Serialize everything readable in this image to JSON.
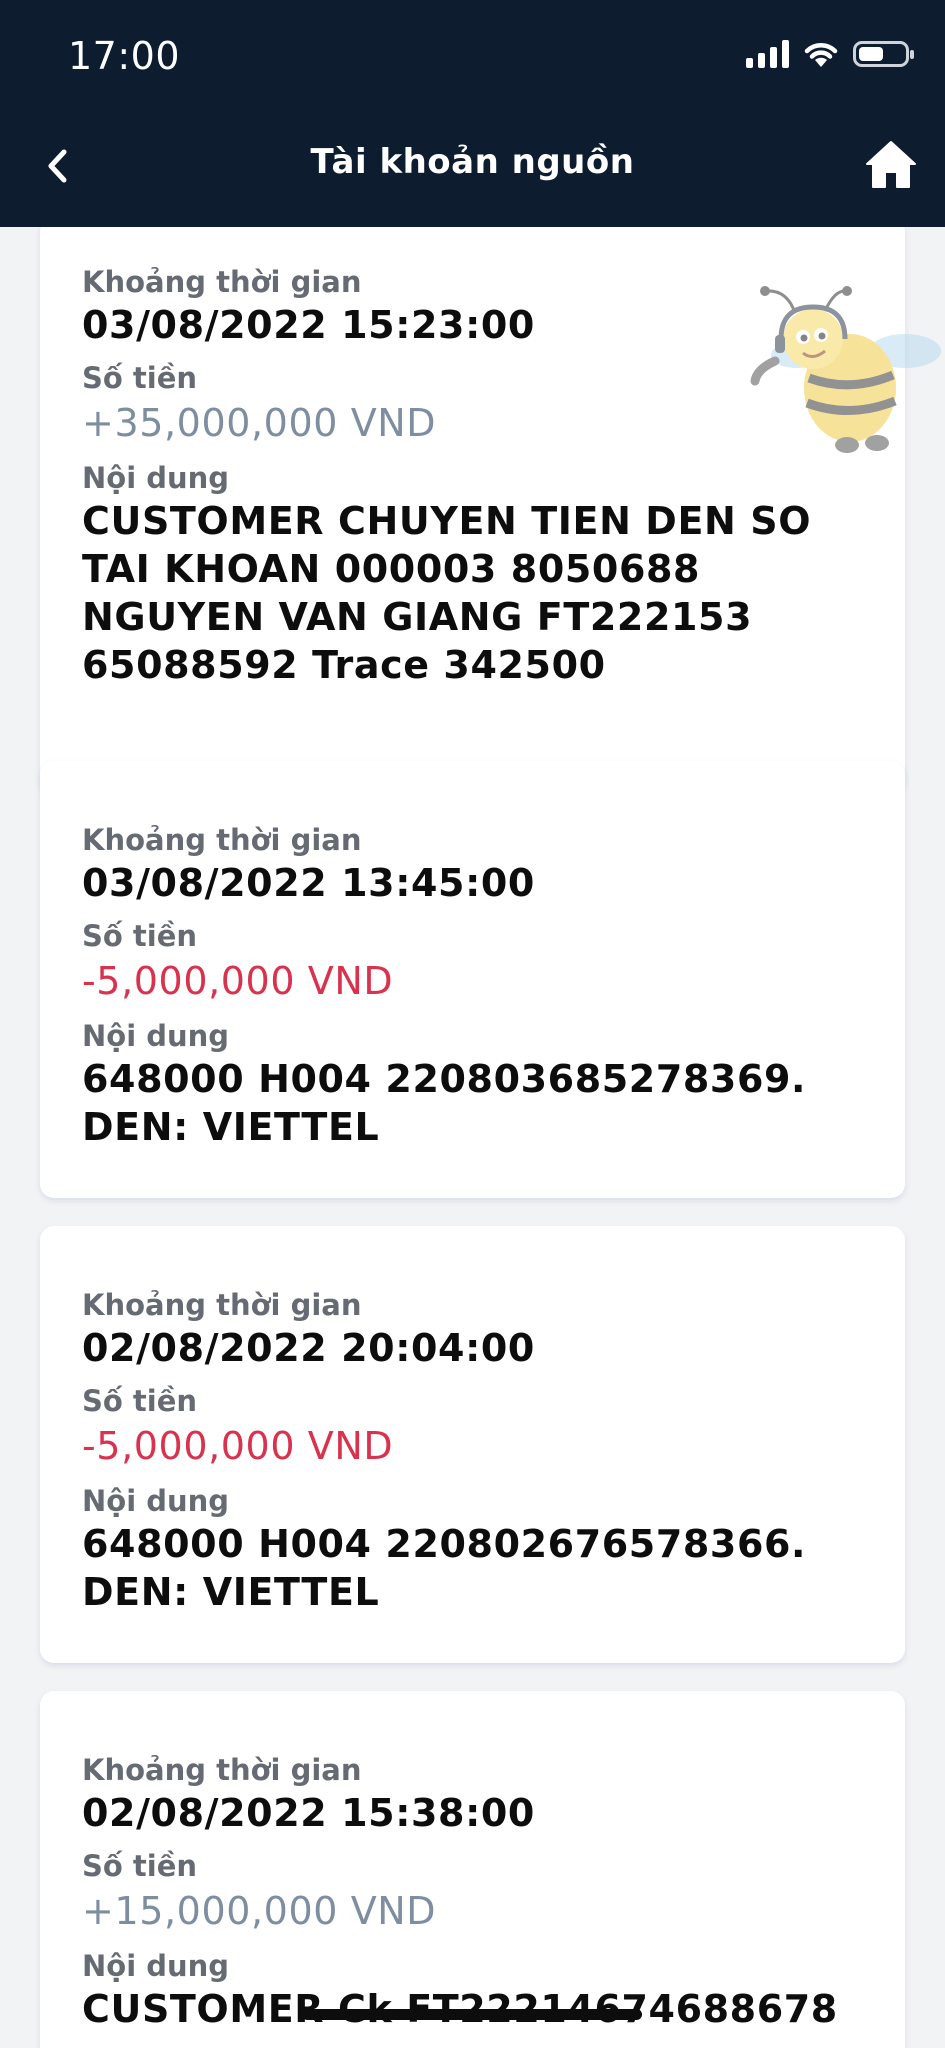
{
  "status_bar": {
    "time": "17:00"
  },
  "nav": {
    "title": "Tài khoản nguồn"
  },
  "labels": {
    "time": "Khoảng thời gian",
    "amount": "Số tiền",
    "content": "Nội dung"
  },
  "transactions": [
    {
      "datetime": "03/08/2022 15:23:00",
      "amount": "+35,000,000 VND",
      "type": "credit",
      "content": "CUSTOMER CHUYEN TIEN DEN SO TAI KHOAN 000003 8050688   NGUYEN VAN GIANG FT222153 65088592 Trace 342500"
    },
    {
      "datetime": "03/08/2022 13:45:00",
      "amount": "-5,000,000 VND",
      "type": "debit",
      "content": "648000 H004 220803685278369. DEN: VIETTEL"
    },
    {
      "datetime": "02/08/2022 20:04:00",
      "amount": "-5,000,000 VND",
      "type": "debit",
      "content": "648000 H004 220802676578366. DEN: VIETTEL"
    },
    {
      "datetime": "02/08/2022 15:38:00",
      "amount": "+15,000,000 VND",
      "type": "credit",
      "content": "CUSTOMER Ck FT22214674688678"
    }
  ],
  "colors": {
    "header_bg": "#0e1c2f",
    "credit": "#7e8ea0",
    "debit": "#d9324e",
    "page_bg": "#f2f3f5"
  },
  "icons": {
    "back": "chevron-left-icon",
    "home": "home-icon",
    "mascot": "bee-mascot-icon"
  }
}
